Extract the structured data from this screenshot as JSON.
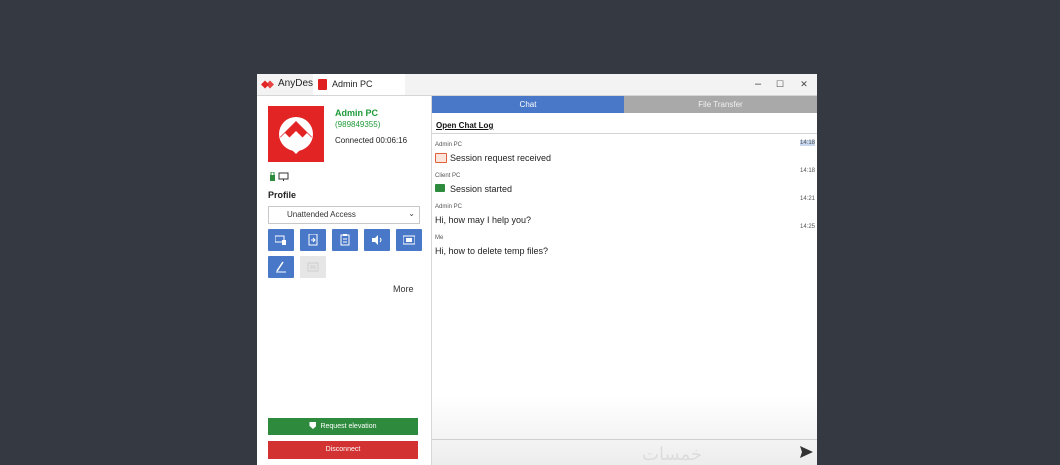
{
  "colors": {
    "accent_blue": "#4a78c8",
    "brand_red": "#e32424",
    "connected_green": "#1f9a3a",
    "elevation_green": "#2e8b3e",
    "disconnect_red": "#d23232"
  },
  "titlebar": {
    "app_name": "AnyDesk",
    "tab_label": "Admin PC",
    "minimize_glyph": "–",
    "maximize_glyph": "☐",
    "close_glyph": "✕"
  },
  "session": {
    "host_name": "Admin PC",
    "host_id": "(989849355)",
    "status": "Connected 00:06:16"
  },
  "profile": {
    "heading": "Profile",
    "selected": "Unattended Access"
  },
  "toolbar": {
    "icons": [
      "keyboard-mouse-icon",
      "file-transfer-icon",
      "clipboard-icon",
      "audio-icon",
      "screen-icon",
      "draw-icon",
      "lock-icon"
    ],
    "more_label": "More"
  },
  "actions": {
    "elevation_label": "Request elevation",
    "disconnect_label": "Disconnect"
  },
  "tabs": {
    "chat": "Chat",
    "file_transfer": "File Transfer"
  },
  "chat": {
    "open_log": "Open Chat Log",
    "messages": [
      {
        "sender": "Admin PC",
        "text": "Session request received",
        "time": "14:18",
        "icon": "session-request-icon"
      },
      {
        "sender": "Client PC",
        "text": "Session started",
        "time": "14:18",
        "icon": "session-started-icon"
      },
      {
        "sender": "Admin PC",
        "text": "Hi, how may I help you?",
        "time": "14:21"
      },
      {
        "sender": "Me",
        "text": "Hi, how to delete temp files?",
        "time": "14:25"
      }
    ]
  },
  "watermark": "خمسات"
}
